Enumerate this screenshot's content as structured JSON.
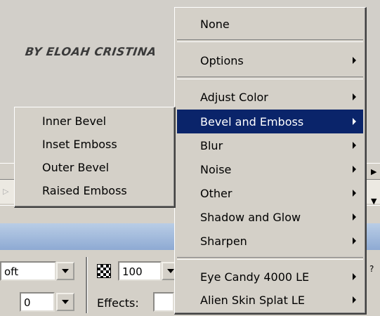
{
  "background": {
    "watermark": "BY ELOAH CRISTINA",
    "panel": {
      "blend_field": "oft",
      "opacity": "100",
      "edge_field": "0",
      "effects_label": "Effects:"
    }
  },
  "menu": {
    "none_label": "None",
    "options_label": "Options",
    "items": [
      "Adjust Color",
      "Bevel and Emboss",
      "Blur",
      "Noise",
      "Other",
      "Shadow and Glow",
      "Sharpen"
    ],
    "highlighted": "Bevel and Emboss",
    "third_party": [
      "Eye Candy 4000 LE",
      "Alien Skin Splat LE"
    ]
  },
  "submenu": {
    "items": [
      "Inner Bevel",
      "Inset Emboss",
      "Outer Bevel",
      "Raised Emboss"
    ]
  },
  "colors": {
    "highlight": "#0a246a",
    "menu_bg": "#d4d0c8"
  }
}
